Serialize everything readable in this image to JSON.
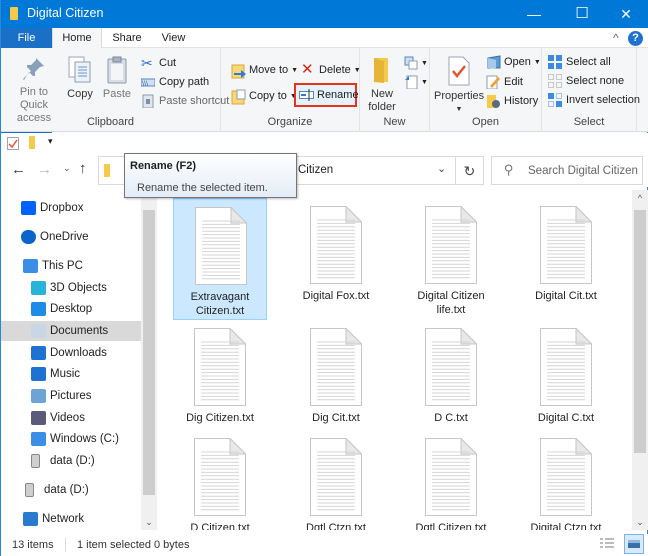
{
  "window": {
    "title": "Digital Citizen",
    "minimize_label": "—",
    "maximize_label": "☐",
    "close_label": "✕"
  },
  "tabs": {
    "file": "File",
    "home": "Home",
    "share": "Share",
    "view": "View",
    "collapse_label": "^",
    "help_label": "?"
  },
  "ribbon": {
    "clipboard": {
      "label": "Clipboard",
      "pin_line1": "Pin to Quick",
      "pin_line2": "access",
      "copy": "Copy",
      "paste": "Paste",
      "cut": "Cut",
      "copy_path": "Copy path",
      "paste_shortcut": "Paste shortcut"
    },
    "organize": {
      "label": "Organize",
      "move_to": "Move to",
      "copy_to": "Copy to",
      "delete": "Delete",
      "rename": "Rename"
    },
    "new": {
      "label": "New",
      "new_folder_line1": "New",
      "new_folder_line2": "folder"
    },
    "open": {
      "label": "Open",
      "properties": "Properties",
      "open": "Open",
      "edit": "Edit",
      "history": "History"
    },
    "select": {
      "label": "Select",
      "select_all": "Select all",
      "select_none": "Select none",
      "invert_selection": "Invert selection"
    }
  },
  "address": {
    "path_visible": "Citizen",
    "search_placeholder": "Search Digital Citizen"
  },
  "tooltip": {
    "title": "Rename (F2)",
    "description": "Rename the selected item."
  },
  "navigation": [
    {
      "label": "Dropbox",
      "icon": "dropbox-icon",
      "selected": false
    },
    {
      "label": "OneDrive",
      "icon": "onedrive-icon",
      "selected": false
    },
    {
      "label": "This PC",
      "icon": "this-pc-icon",
      "selected": false
    },
    {
      "label": "3D Objects",
      "icon": "3d-objects-icon",
      "selected": false
    },
    {
      "label": "Desktop",
      "icon": "desktop-icon",
      "selected": false
    },
    {
      "label": "Documents",
      "icon": "documents-icon",
      "selected": true
    },
    {
      "label": "Downloads",
      "icon": "downloads-icon",
      "selected": false
    },
    {
      "label": "Music",
      "icon": "music-icon",
      "selected": false
    },
    {
      "label": "Pictures",
      "icon": "pictures-icon",
      "selected": false
    },
    {
      "label": "Videos",
      "icon": "videos-icon",
      "selected": false
    },
    {
      "label": "Windows (C:)",
      "icon": "drive-c-icon",
      "selected": false
    },
    {
      "label": "data (D:)",
      "icon": "drive-d-icon",
      "selected": false
    },
    {
      "label": "data (D:)",
      "icon": "drive-d-icon",
      "selected": false
    },
    {
      "label": "Network",
      "icon": "network-icon",
      "selected": false
    }
  ],
  "files": [
    {
      "name": "Extravagant Citizen.txt",
      "selected": true
    },
    {
      "name": "Digital Fox.txt",
      "selected": false
    },
    {
      "name": "Digital Citizen life.txt",
      "selected": false
    },
    {
      "name": "Digital Cit.txt",
      "selected": false
    },
    {
      "name": "Dig Citizen.txt",
      "selected": false
    },
    {
      "name": "Dig Cit.txt",
      "selected": false
    },
    {
      "name": "D C.txt",
      "selected": false
    },
    {
      "name": "Digital C.txt",
      "selected": false
    },
    {
      "name": "D Citizen.txt",
      "selected": false
    },
    {
      "name": "Dgtl Ctzn.txt",
      "selected": false
    },
    {
      "name": "Dgtl Citizen.txt",
      "selected": false
    },
    {
      "name": "Digital Ctzn.txt",
      "selected": false
    }
  ],
  "status": {
    "item_count": "13 items",
    "selection": "1 item selected",
    "size": "0 bytes"
  },
  "colors": {
    "titlebar": "#0078d7",
    "highlight_box": "#e8321c",
    "selection_bg": "#cce8ff"
  }
}
